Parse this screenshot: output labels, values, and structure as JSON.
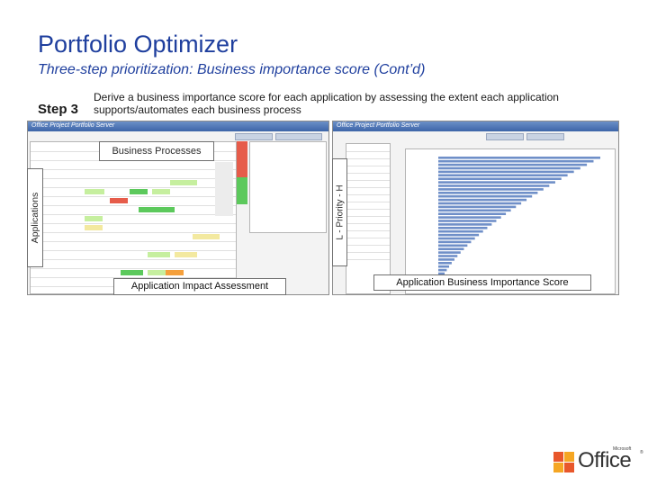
{
  "slide": {
    "title": "Portfolio Optimizer",
    "subtitle": "Three-step prioritization: Business importance score (Cont’d)",
    "step": {
      "label": "Step 3",
      "description": "Derive a business importance score for each application by assessing the extent each application supports/automates each business process"
    }
  },
  "left_screenshot": {
    "banner": "Business Processes",
    "side_tag": "Applications",
    "caption": "Application Impact Assessment"
  },
  "right_screenshot": {
    "side_tag": "L - Priority - H",
    "caption": "Application Business Importance Score"
  },
  "footer": {
    "logo_word": "Office",
    "logo_small": "Microsoft",
    "logo_tm": "®"
  },
  "colors": {
    "title": "#1f3f9e",
    "cell_green": "#5cc95c",
    "cell_lightgreen": "#c6ef9f",
    "cell_yellow": "#f3e9a0",
    "cell_red": "#e65c4a",
    "cell_orange": "#f5a03c",
    "bar_blue": "#6f8fc8",
    "office_red": "#e8572b",
    "office_orange": "#f5a623"
  }
}
